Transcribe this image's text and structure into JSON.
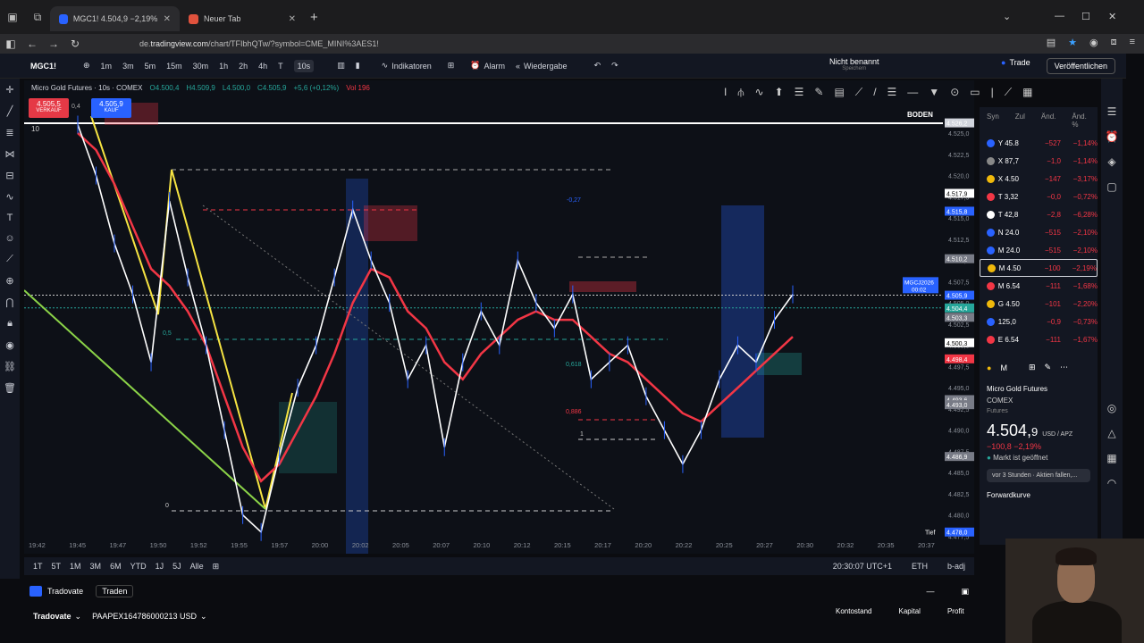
{
  "browser": {
    "tabs": [
      {
        "label": "MGC1! 4.504,9 −2,19% Nicht",
        "active": true
      },
      {
        "label": "Neuer Tab",
        "active": false
      }
    ],
    "url_prefix": "de.",
    "url_host": "tradingview.com",
    "url_path": "/chart/TFIbhQTw/?symbol=CME_MINI%3AES1!"
  },
  "toolbar": {
    "symbol": "MGC1!",
    "intervals": [
      "1m",
      "3m",
      "5m",
      "15m",
      "30m",
      "1h",
      "2h",
      "4h",
      "T",
      "10s"
    ],
    "selected_interval": "10s",
    "indicators_label": "Indikatoren",
    "alarm_label": "Alarm",
    "replay_label": "Wiedergabe",
    "layout_name": "Nicht benannt",
    "layout_sub": "Speichern",
    "trade_label": "Trade",
    "publish_label": "Veröffentlichen"
  },
  "chart": {
    "legend_title": "Micro Gold Futures · 10s · COMEX",
    "legend_open": "O4.500,4",
    "legend_high": "H4.509,9",
    "legend_low": "L4.500,0",
    "legend_close": "C4.505,9",
    "legend_change": "+5,6 (+0,12%)",
    "legend_vol": "Vol 196",
    "sell_price": "4.505,5",
    "sell_label": "VERKAUF",
    "buy_price": "4.505,9",
    "buy_label": "KAUF",
    "spread": "0,4",
    "boden_label": "BODEN",
    "qty": "10",
    "tief_label": "Tief",
    "symbol_tag": "MGCJ2026",
    "countdown": "00:02"
  },
  "chart_data": {
    "type": "line",
    "x_labels": [
      "19:42",
      "19:45",
      "19:47",
      "19:50",
      "19:52",
      "19:55",
      "19:57",
      "20:00",
      "20:02",
      "20:05",
      "20:07",
      "20:10",
      "20:12",
      "20:15",
      "20:17",
      "20:20",
      "20:22",
      "20:25",
      "20:27",
      "20:30",
      "20:32",
      "20:35",
      "20:37"
    ],
    "y_ticks": [
      "4.525,0",
      "4.522,5",
      "4.520,0",
      "4.517,5",
      "4.515,0",
      "4.512,5",
      "4.510,0",
      "4.507,5",
      "4.505,0",
      "4.502,5",
      "4.500,0",
      "4.497,5",
      "4.495,0",
      "4.492,5",
      "4.490,0",
      "4.487,5",
      "4.485,0",
      "4.482,5",
      "4.480,0",
      "4.477,5"
    ],
    "ylim": [
      4476.5,
      4527
    ],
    "price_labels": [
      {
        "text": "4.526,2",
        "value": 4526.2,
        "color": "#d1d4dc"
      },
      {
        "text": "4.517,9",
        "value": 4517.9,
        "color": "#ffffff"
      },
      {
        "text": "4.515,8",
        "value": 4515.8,
        "color": "#2962ff"
      },
      {
        "text": "4.510,2",
        "value": 4510.2,
        "color": "#787b86"
      },
      {
        "text": "4.505,9",
        "value": 4505.9,
        "color": "#2962ff"
      },
      {
        "text": "4.504,4",
        "value": 4504.4,
        "color": "#26a69a"
      },
      {
        "text": "4.503,3",
        "value": 4503.3,
        "color": "#787b86"
      },
      {
        "text": "4.500,3",
        "value": 4500.3,
        "color": "#ffffff"
      },
      {
        "text": "4.498,4",
        "value": 4498.4,
        "color": "#f23645"
      },
      {
        "text": "4.493,6",
        "value": 4493.6,
        "color": "#787b86"
      },
      {
        "text": "4.493,0",
        "value": 4493.0,
        "color": "#787b86"
      },
      {
        "text": "4.486,9",
        "value": 4486.9,
        "color": "#787b86"
      },
      {
        "text": "4.478,0",
        "value": 4478.0,
        "color": "#2962ff"
      }
    ],
    "series": [
      {
        "name": "",
        "color": "#ffffff",
        "values": [
          4526,
          4520,
          4512,
          4506,
          4498,
          4517,
          4508,
          4500,
          4490,
          4480,
          4478,
          4487,
          4495,
          4500,
          4508,
          4516,
          4510,
          4505,
          4496,
          4500,
          4488,
          4498,
          4504,
          4500,
          4510,
          4505,
          4502,
          4506,
          4496,
          4498,
          4500,
          4494,
          4490,
          4486,
          4490,
          4496,
          4500,
          4498,
          4503,
          4506
        ]
      },
      {
        "name": "",
        "color": "#f23645",
        "values": [
          4525,
          4523,
          4519,
          4514,
          4509,
          4507,
          4504,
          4500,
          4494,
          4488,
          4484,
          4486,
          4490,
          4494,
          4499,
          4505,
          4509,
          4508,
          4504,
          4502,
          4498,
          4496,
          4499,
          4501,
          4503,
          4504,
          4503,
          4503,
          4501,
          4499,
          4498,
          4496,
          4494,
          4492,
          4491,
          4493,
          4495,
          4497,
          4499,
          4501
        ]
      }
    ]
  },
  "fib_labels": [
    "0,5",
    "0,618",
    "0,886",
    "0",
    "1",
    "-0,27"
  ],
  "range_bar": {
    "ranges": [
      "1T",
      "5T",
      "1M",
      "3M",
      "6M",
      "YTD",
      "1J",
      "5J",
      "Alle"
    ],
    "clock": "20:30:07 UTC+1",
    "session": "ETH",
    "adj": "b-adj"
  },
  "trade_panel": {
    "broker": "Tradovate",
    "trade_btn": "Traden",
    "account": "PAAPEX164786000213 USD",
    "cols": [
      "Kontostand",
      "Kapital",
      "Profit"
    ]
  },
  "watchlist": {
    "headers": [
      "Syn",
      "Zul",
      "Änd.",
      "Änd. %"
    ],
    "rows": [
      {
        "sym": "Y",
        "last": "45.8",
        "chg": "−527",
        "pct": "−1,14%",
        "color": "#2962ff"
      },
      {
        "sym": "X",
        "last": "87,7",
        "chg": "−1,0",
        "pct": "−1,14%",
        "color": "#888888"
      },
      {
        "sym": "X",
        "last": "4.50",
        "chg": "−147",
        "pct": "−3,17%",
        "color": "#f0b90b"
      },
      {
        "sym": "T",
        "last": "3,32",
        "chg": "−0,0",
        "pct": "−0,72%",
        "color": "#f23645"
      },
      {
        "sym": "T",
        "last": "42,8",
        "chg": "−2,8",
        "pct": "−6,28%",
        "color": "#ffffff"
      },
      {
        "sym": "N",
        "last": "24.0",
        "chg": "−515",
        "pct": "−2,10%",
        "color": "#2962ff"
      },
      {
        "sym": "M",
        "last": "24.0",
        "chg": "−515",
        "pct": "−2,10%",
        "color": "#2962ff"
      },
      {
        "sym": "M",
        "last": "4.50",
        "chg": "−100",
        "pct": "−2,19%",
        "color": "#f0b90b"
      },
      {
        "sym": "M",
        "last": "6.54",
        "chg": "−111",
        "pct": "−1,68%",
        "color": "#f23645"
      },
      {
        "sym": "G",
        "last": "4.50",
        "chg": "−101",
        "pct": "−2,20%",
        "color": "#f0b90b"
      },
      {
        "sym": "",
        "last": "125,0",
        "chg": "−0,9",
        "pct": "−0,73%",
        "color": "#2962ff"
      },
      {
        "sym": "E",
        "last": "6.54",
        "chg": "−111",
        "pct": "−1,67%",
        "color": "#f23645"
      }
    ],
    "selected_index": 7
  },
  "detail": {
    "sym_short": "M",
    "name": "Micro Gold Futures",
    "exchange": "COMEX",
    "type": "Futures",
    "price_main": "4.504,",
    "price_frac": "9",
    "currency": "USD / APZ",
    "change": "−100,8  −2,19%",
    "market_status": "Markt ist geöffnet",
    "news": "vor 3 Stunden · Aktien fallen,...",
    "forward": "Forwardkurve"
  }
}
